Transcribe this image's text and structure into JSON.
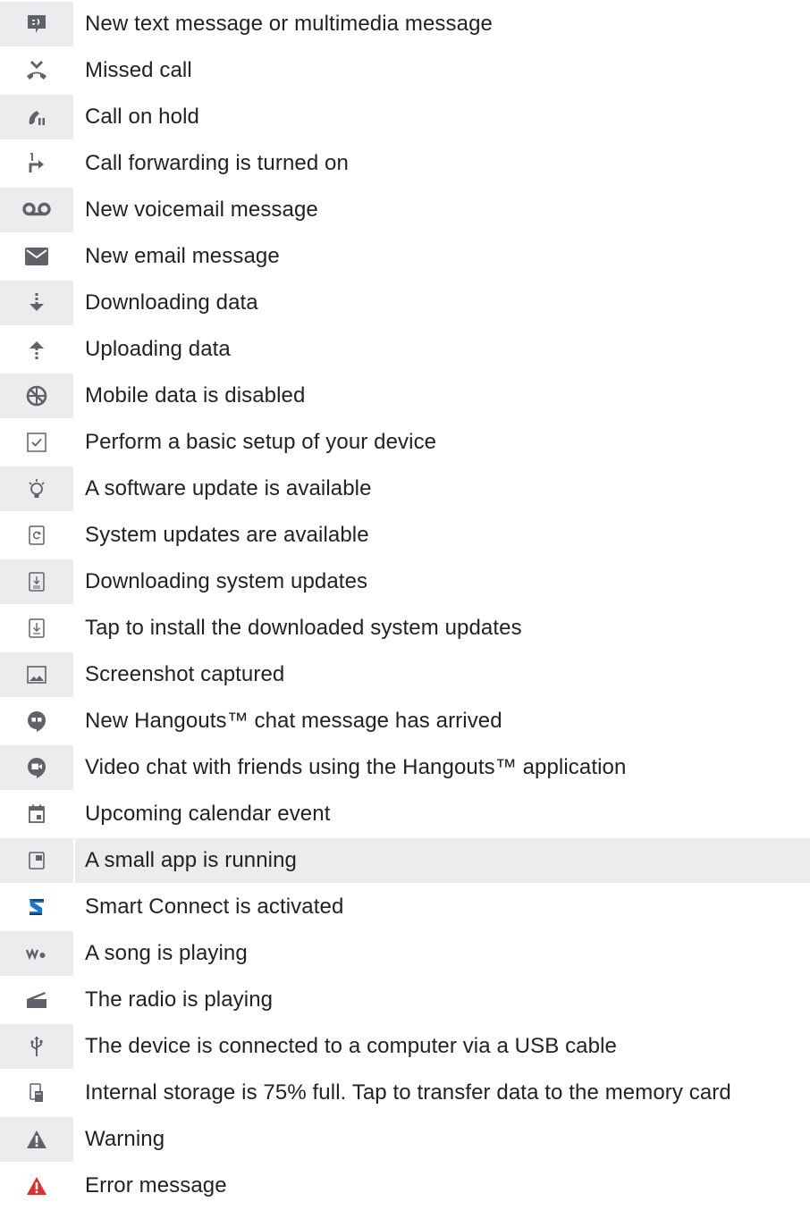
{
  "rows": [
    {
      "icon": "message-icon",
      "label": "New text message or multimedia message",
      "icon_bg": true,
      "text_bg": false
    },
    {
      "icon": "missed-call-icon",
      "label": "Missed call",
      "icon_bg": false,
      "text_bg": false
    },
    {
      "icon": "call-on-hold-icon",
      "label": "Call on hold",
      "icon_bg": true,
      "text_bg": false
    },
    {
      "icon": "call-forwarding-icon",
      "label": "Call forwarding is turned on",
      "icon_bg": false,
      "text_bg": false
    },
    {
      "icon": "voicemail-icon",
      "label": "New voicemail message",
      "icon_bg": true,
      "text_bg": false
    },
    {
      "icon": "email-icon",
      "label": "New email message",
      "icon_bg": false,
      "text_bg": false
    },
    {
      "icon": "download-icon",
      "label": "Downloading data",
      "icon_bg": true,
      "text_bg": false
    },
    {
      "icon": "upload-icon",
      "label": "Uploading data",
      "icon_bg": false,
      "text_bg": false
    },
    {
      "icon": "mobile-data-disabled-icon",
      "label": "Mobile data is disabled",
      "icon_bg": true,
      "text_bg": false
    },
    {
      "icon": "setup-checkbox-icon",
      "label": "Perform a basic setup of your device",
      "icon_bg": false,
      "text_bg": false
    },
    {
      "icon": "software-update-bulb-icon",
      "label": "A software update is available",
      "icon_bg": true,
      "text_bg": false
    },
    {
      "icon": "system-update-icon",
      "label": "System updates are available",
      "icon_bg": false,
      "text_bg": false
    },
    {
      "icon": "downloading-system-update-icon",
      "label": "Downloading system updates",
      "icon_bg": true,
      "text_bg": false
    },
    {
      "icon": "install-update-icon",
      "label": "Tap to install the downloaded system updates",
      "icon_bg": false,
      "text_bg": false
    },
    {
      "icon": "screenshot-icon",
      "label": "Screenshot captured",
      "icon_bg": true,
      "text_bg": false
    },
    {
      "icon": "hangouts-chat-icon",
      "label": "New Hangouts™ chat message has arrived",
      "icon_bg": false,
      "text_bg": false
    },
    {
      "icon": "hangouts-video-icon",
      "label": "Video chat with friends using the Hangouts™ application",
      "icon_bg": true,
      "text_bg": false
    },
    {
      "icon": "calendar-icon",
      "label": "Upcoming calendar event",
      "icon_bg": false,
      "text_bg": false
    },
    {
      "icon": "small-app-icon",
      "label": "A small app is running",
      "icon_bg": true,
      "text_bg": true
    },
    {
      "icon": "smart-connect-icon",
      "label": "Smart Connect is activated",
      "icon_bg": false,
      "text_bg": false
    },
    {
      "icon": "walkman-icon",
      "label": "A song is playing",
      "icon_bg": true,
      "text_bg": false
    },
    {
      "icon": "radio-icon",
      "label": "The radio is playing",
      "icon_bg": false,
      "text_bg": false
    },
    {
      "icon": "usb-icon",
      "label": "The device is connected to a computer via a USB cable",
      "icon_bg": true,
      "text_bg": false
    },
    {
      "icon": "storage-icon",
      "label": "Internal storage is 75% full. Tap to transfer data to the memory card",
      "icon_bg": false,
      "text_bg": false
    },
    {
      "icon": "warning-icon",
      "label": "Warning",
      "icon_bg": true,
      "text_bg": false
    },
    {
      "icon": "error-icon",
      "label": "Error message",
      "icon_bg": false,
      "text_bg": false
    }
  ],
  "colors": {
    "icon_gray": "#5f6368",
    "shade": "#ececee",
    "error_red": "#d8302b",
    "smart_connect_blue": "#1f74c9"
  }
}
